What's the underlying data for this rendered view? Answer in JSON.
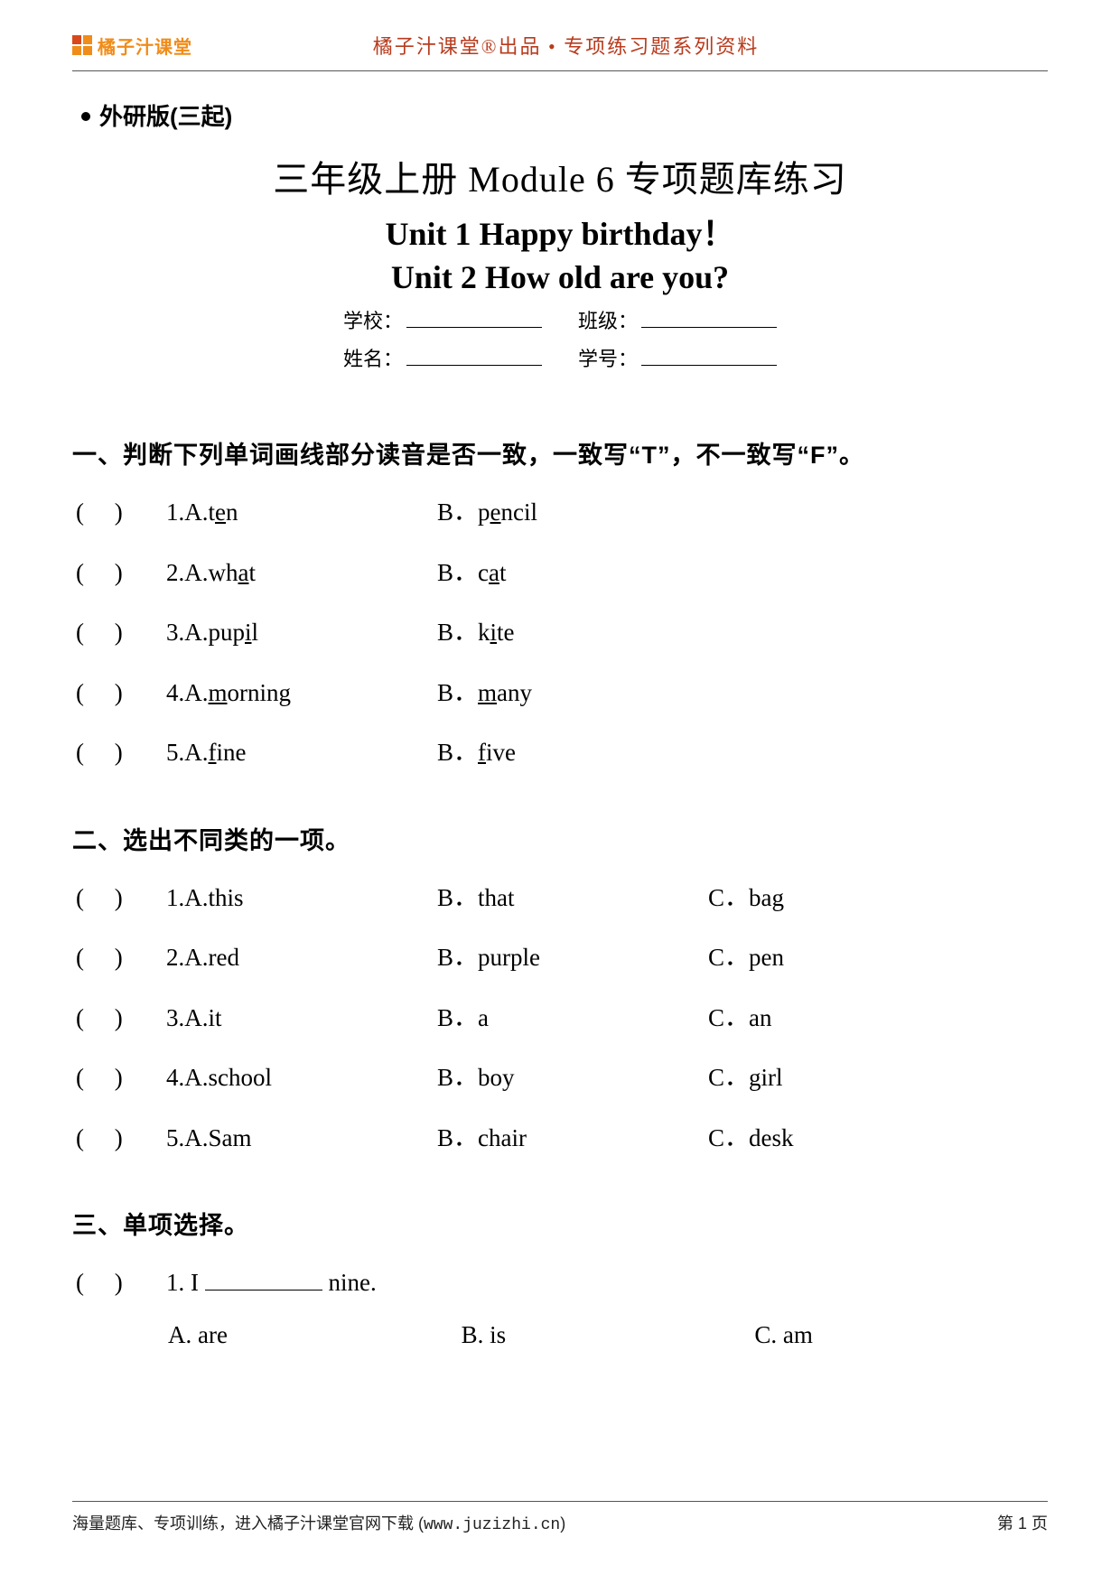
{
  "header": {
    "brand": "橘子汁课堂",
    "tagline": "橘子汁课堂®出品 • 专项练习题系列资料"
  },
  "edition": "外研版(三起)",
  "titles": {
    "main_pre": "三年级上册 ",
    "main_en": "Module 6 ",
    "main_post": "专项题库练习",
    "unit1": "Unit 1 Happy birthday！",
    "unit2": "Unit 2 How old are you?"
  },
  "info": {
    "school_label": "学校：",
    "class_label": "班级：",
    "name_label": "姓名：",
    "id_label": "学号："
  },
  "sections": {
    "s1": {
      "title": "一、判断下列单词画线部分读音是否一致，一致写“T”，不一致写“F”。",
      "q1": {
        "a_pre": "1.A.t",
        "a_u": "e",
        "a_post": "n",
        "b_pre": "B．p",
        "b_u": "e",
        "b_post": "ncil"
      },
      "q2": {
        "a_pre": "2.A.wh",
        "a_u": "a",
        "a_post": "t",
        "b_pre": "B．c",
        "b_u": "a",
        "b_post": "t"
      },
      "q3": {
        "a_pre": "3.A.pup",
        "a_u": "i",
        "a_post": "l",
        "b_pre": "B．k",
        "b_u": "i",
        "b_post": "te"
      },
      "q4": {
        "a_pre": "4.A.",
        "a_u": "m",
        "a_post": "orning",
        "b_pre": "B．",
        "b_u": "m",
        "b_post": "any"
      },
      "q5": {
        "a_pre": "5.A.",
        "a_u": "f",
        "a_post": "ine",
        "b_pre": "B．",
        "b_u": "f",
        "b_post": "ive"
      }
    },
    "s2": {
      "title": "二、选出不同类的一项。",
      "q1": {
        "a": "1.A.this",
        "b": "B．that",
        "c": "C．bag"
      },
      "q2": {
        "a": "2.A.red",
        "b": "B．purple",
        "c": "C．pen"
      },
      "q3": {
        "a": "3.A.it",
        "b": "B．a",
        "c": "C．an"
      },
      "q4": {
        "a": "4.A.school",
        "b": "B．boy",
        "c": "C．girl"
      },
      "q5": {
        "a": "5.A.Sam",
        "b": "B．chair",
        "c": "C．desk"
      }
    },
    "s3": {
      "title": "三、单项选择。",
      "q1": {
        "stem_pre": "1. I ",
        "stem_post": " nine.",
        "a": "A. are",
        "b": "B. is",
        "c": "C. am"
      }
    }
  },
  "paren_open": "(",
  "paren_close": ")",
  "footer": {
    "left_pre": "海量题库、专项训练，进入橘子汁课堂官网下载 (",
    "url": "www.juzizhi.cn",
    "left_post": ")",
    "page": "第 1 页"
  }
}
